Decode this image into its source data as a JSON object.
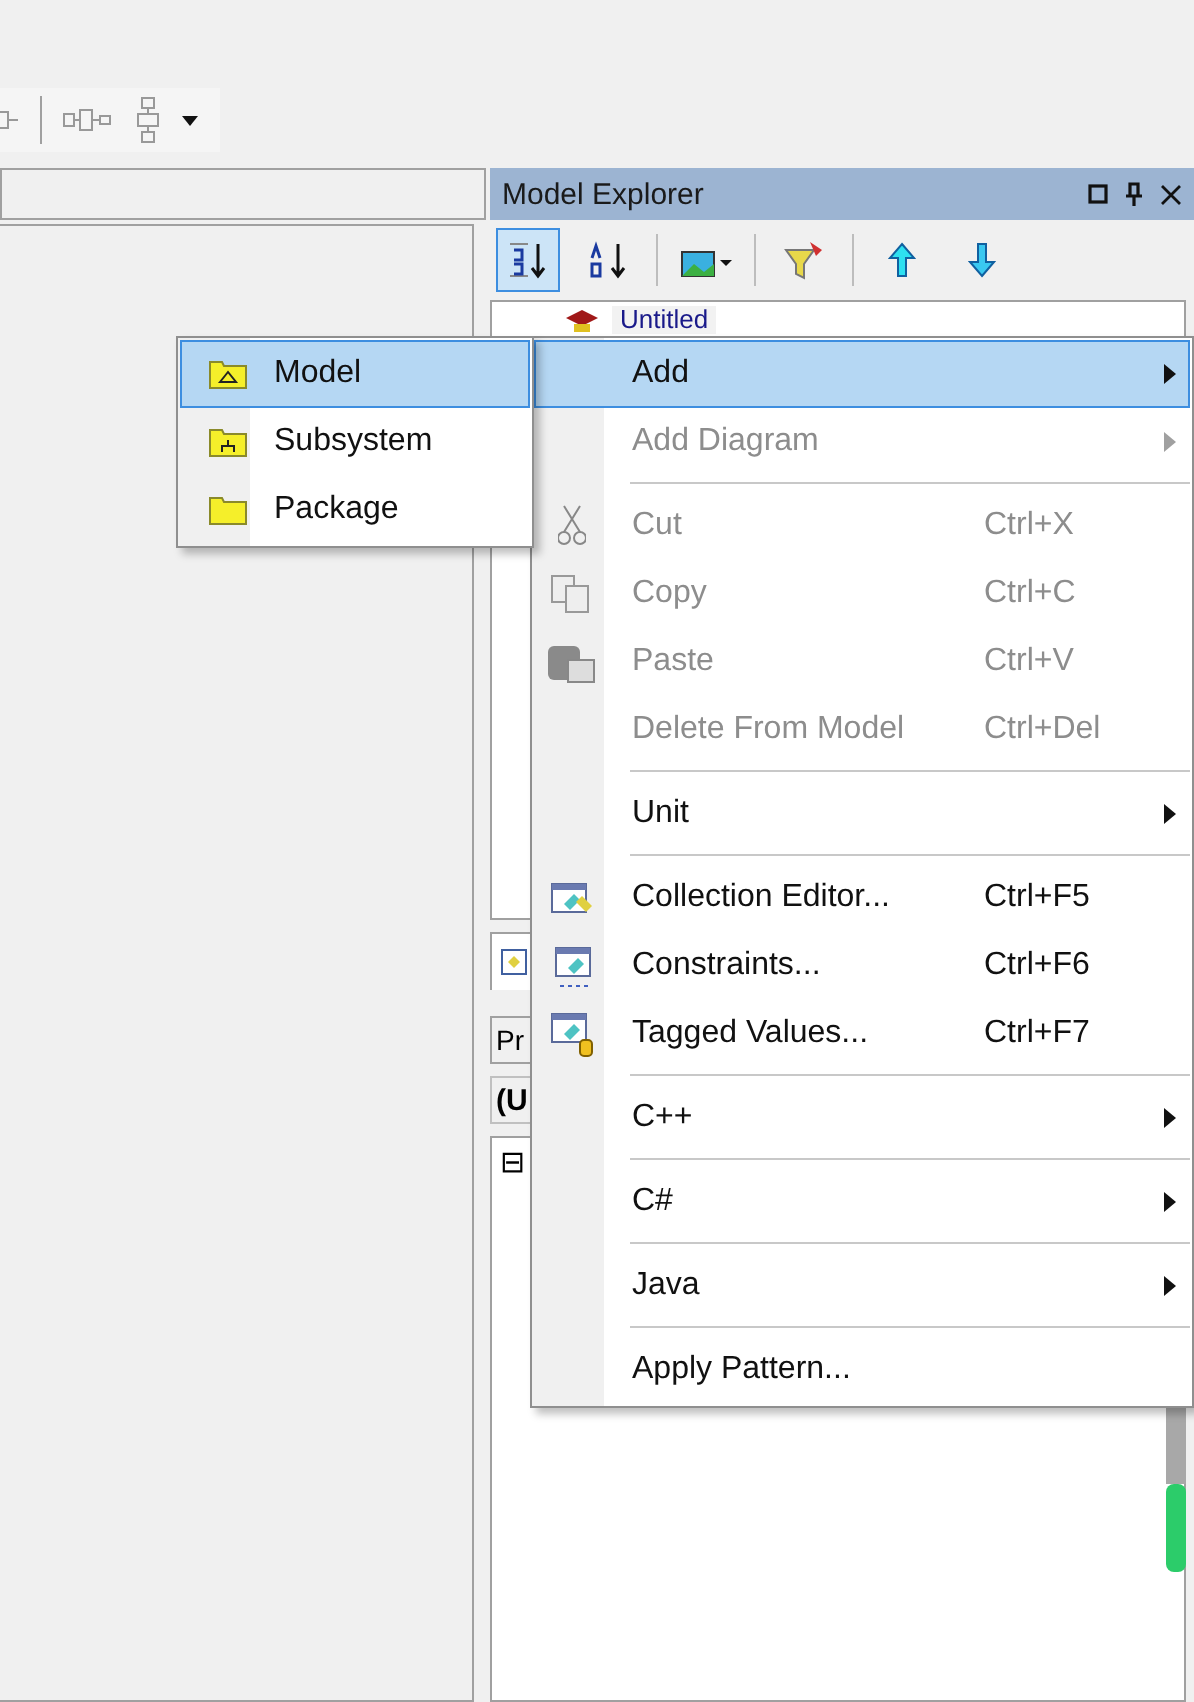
{
  "explorer": {
    "title": "Model Explorer",
    "tree": [
      {
        "label": "Untitled"
      }
    ],
    "properties_button": "Pr",
    "properties_header": "(U",
    "collapse_glyph": "⊟"
  },
  "context_menu": {
    "items": [
      {
        "kind": "item",
        "label": "Add",
        "selected": true,
        "disabled": false,
        "submenu": true
      },
      {
        "kind": "item",
        "label": "Add Diagram",
        "selected": false,
        "disabled": true,
        "submenu": true
      },
      {
        "kind": "separator"
      },
      {
        "kind": "item",
        "label": "Cut",
        "shortcut": "Ctrl+X",
        "selected": false,
        "disabled": true,
        "submenu": false
      },
      {
        "kind": "item",
        "label": "Copy",
        "shortcut": "Ctrl+C",
        "selected": false,
        "disabled": true,
        "submenu": false
      },
      {
        "kind": "item",
        "label": "Paste",
        "shortcut": "Ctrl+V",
        "selected": false,
        "disabled": true,
        "submenu": false
      },
      {
        "kind": "item",
        "label": "Delete From Model",
        "shortcut": "Ctrl+Del",
        "selected": false,
        "disabled": true,
        "submenu": false
      },
      {
        "kind": "separator"
      },
      {
        "kind": "item",
        "label": "Unit",
        "selected": false,
        "disabled": false,
        "submenu": true
      },
      {
        "kind": "separator"
      },
      {
        "kind": "item",
        "label": "Collection Editor...",
        "shortcut": "Ctrl+F5",
        "selected": false,
        "disabled": false,
        "submenu": false
      },
      {
        "kind": "item",
        "label": "Constraints...",
        "shortcut": "Ctrl+F6",
        "selected": false,
        "disabled": false,
        "submenu": false
      },
      {
        "kind": "item",
        "label": "Tagged Values...",
        "shortcut": "Ctrl+F7",
        "selected": false,
        "disabled": false,
        "submenu": false
      },
      {
        "kind": "separator"
      },
      {
        "kind": "item",
        "label": "C++",
        "selected": false,
        "disabled": false,
        "submenu": true
      },
      {
        "kind": "separator"
      },
      {
        "kind": "item",
        "label": "C#",
        "selected": false,
        "disabled": false,
        "submenu": true
      },
      {
        "kind": "separator"
      },
      {
        "kind": "item",
        "label": "Java",
        "selected": false,
        "disabled": false,
        "submenu": true
      },
      {
        "kind": "separator"
      },
      {
        "kind": "item",
        "label": "Apply Pattern...",
        "selected": false,
        "disabled": false,
        "submenu": false
      }
    ]
  },
  "add_submenu": {
    "items": [
      {
        "label": "Model",
        "selected": true
      },
      {
        "label": "Subsystem",
        "selected": false
      },
      {
        "label": "Package",
        "selected": false
      }
    ]
  }
}
